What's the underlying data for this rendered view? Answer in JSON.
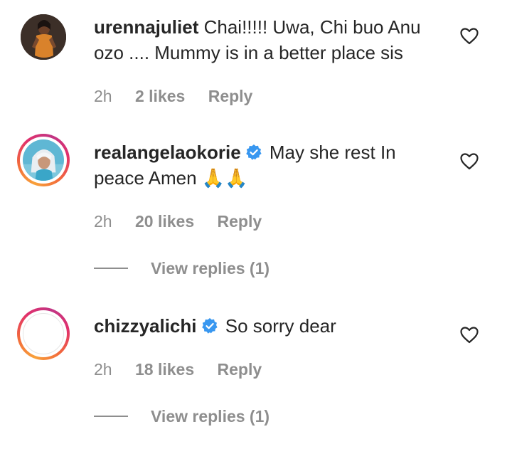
{
  "comments": [
    {
      "username": "urennajuliet",
      "verified": false,
      "text": "Chai!!!!! Uwa, Chi buo Anu ozo .... Mummy is in a better place sis",
      "time": "2h",
      "likes": "2 likes",
      "reply_label": "Reply",
      "view_replies": null
    },
    {
      "username": "realangelaokorie",
      "verified": true,
      "text": "May she rest In peace Amen 🙏🙏",
      "time": "2h",
      "likes": "20 likes",
      "reply_label": "Reply",
      "view_replies": "View replies (1)"
    },
    {
      "username": "chizzyalichi",
      "verified": true,
      "text": "So sorry dear",
      "time": "2h",
      "likes": "18 likes",
      "reply_label": "Reply",
      "view_replies": "View replies (1)"
    }
  ],
  "colors": {
    "text": "#262626",
    "muted": "#8e8e8e",
    "verified_blue": "#3897f0"
  },
  "icons": {
    "like": "heart-outline-icon",
    "verified": "verified-badge-icon"
  }
}
